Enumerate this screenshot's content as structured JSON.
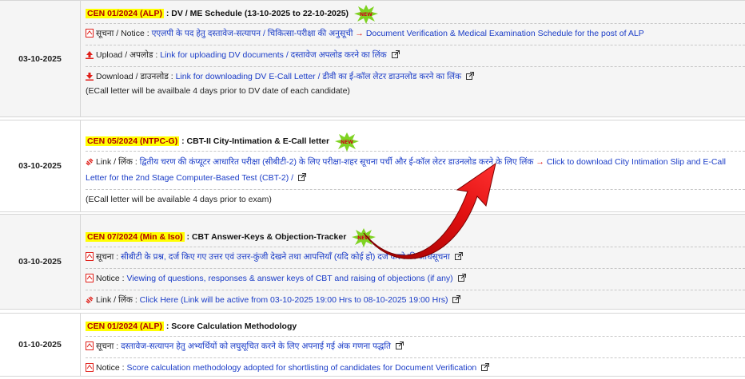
{
  "rows": [
    {
      "date": "03-10-2025",
      "tag": "CEN 01/2024 (ALP)",
      "title": " : DV / ME Schedule (13-10-2025 to 22-10-2025)",
      "items": [
        {
          "prefix": "सूचना / Notice : ",
          "link": "एएलपी के पद हेतु दस्तावेज-सत्यापन / चिकित्सा-परीक्षा की अनुसूची",
          "arrow": "→",
          "link2": "Document Verification & Medical Examination Schedule for the post of ALP"
        },
        {
          "prefix": "Upload / अपलोड : ",
          "link": "Link for uploading DV documents / दस्तावेज अपलोड करने का लिंक"
        },
        {
          "prefix": "Download / डाउनलोड : ",
          "link": "Link for downloading DV E-Call Letter / डीवी का ई-कॉल लेटर डाउनलोड करने का लिंक",
          "note": "(ECall letter will be availbale 4 days prior to DV date of each candidate)"
        }
      ]
    },
    {
      "date": "03-10-2025",
      "tag": "CEN 05/2024 (NTPC-G)",
      "title": " : CBT-II City-Intimation & E-Call letter",
      "items": [
        {
          "prefix": "Link / लिंक : ",
          "link": "द्वितीय चरण की कंप्यूटर आधारित परीक्षा (सीबीटी-2) के लिए परीक्षा-शहर सूचना पर्ची और ई-कॉल लेटर डाउनलोड करने के लिए लिंक",
          "arrow": "→",
          "link2": "Click to download City Intimation Slip and E-Call Letter for the 2nd Stage Computer-Based Test (CBT-2) /"
        },
        {
          "note": "(ECall letter will be available 4 days prior to exam)"
        }
      ]
    },
    {
      "date": "03-10-2025",
      "tag": "CEN 07/2024 (Min & Iso)",
      "title": " : CBT Answer-Keys & Objection-Tracker",
      "items": [
        {
          "prefix": "सूचना : ",
          "link": "सीबीटी के प्रश्न, दर्ज किए गए उत्तर एवं उत्तर-कुंजी देखने तथा आपत्तियाँ (यदि कोई हो) दर्ज करने की अधिसूचना"
        },
        {
          "prefix": "Notice : ",
          "link": "Viewing of questions, responses & answer keys of CBT and raising of objections (if any)"
        },
        {
          "prefix": "Link / लिंक : ",
          "link": "Click Here (Link will be active from 03-10-2025 19:00 Hrs to 08-10-2025 19:00 Hrs)"
        }
      ]
    },
    {
      "date": "01-10-2025",
      "tag": "CEN 01/2024 (ALP)",
      "title": " : Score Calculation Methodology",
      "items": [
        {
          "prefix": "सूचना : ",
          "link": "दस्तावेज-सत्यापन हेतु अभ्यर्थियों को लघुसूचित करने के लिए अपनाई गई अंक गणना पद्धति"
        },
        {
          "prefix": "Notice : ",
          "link": "Score calculation methodology adopted for shortlisting of candidates for Document Verification"
        }
      ]
    }
  ],
  "new_badge": "NEW",
  "colors": {
    "highlight": "#ffff00",
    "link": "#1a3cc7",
    "tag_text": "#b00000",
    "arrow_red": "#e0201a"
  }
}
